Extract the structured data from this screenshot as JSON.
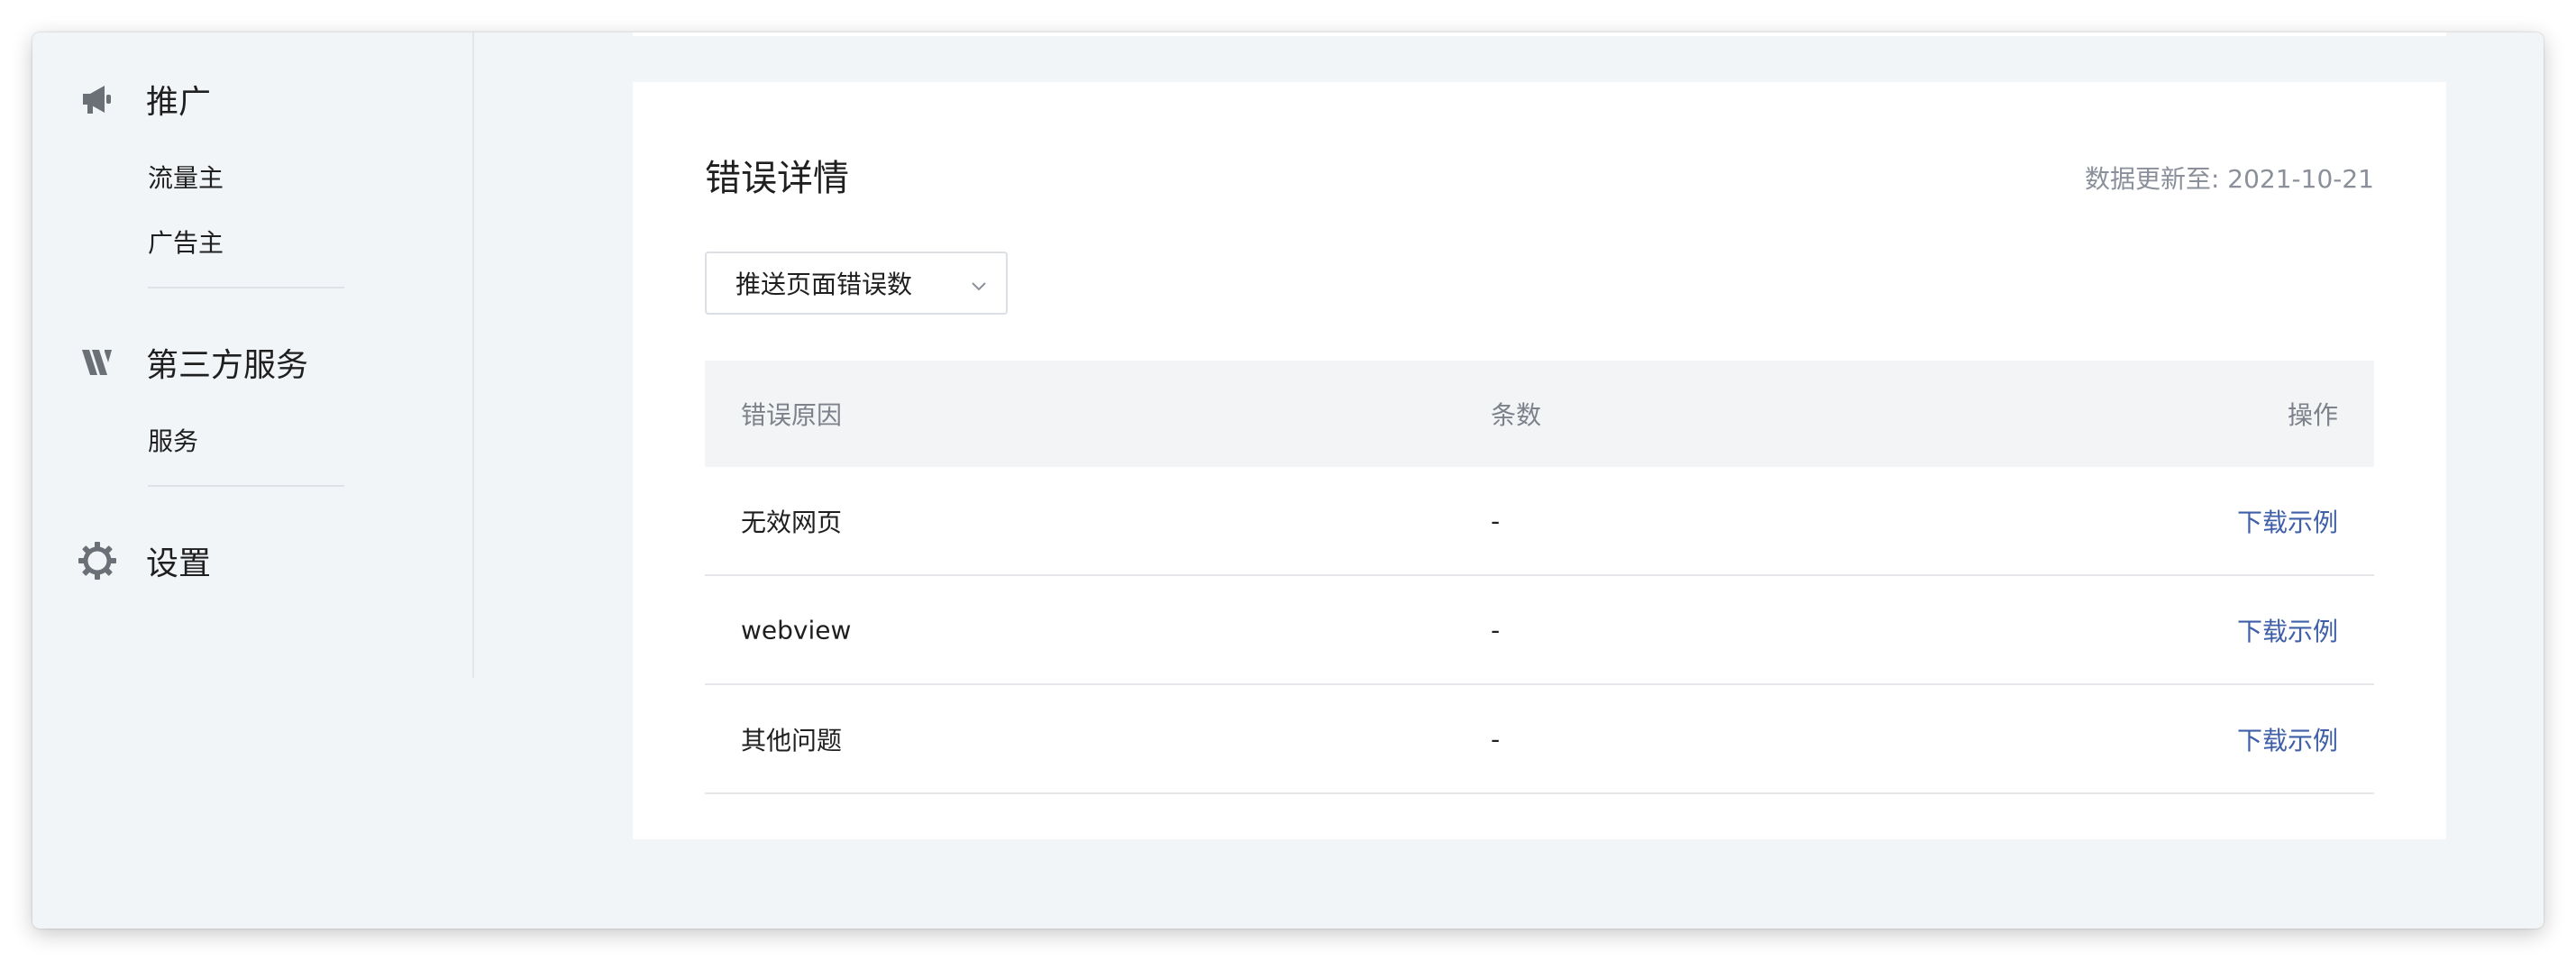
{
  "sidebar": {
    "groups": [
      {
        "label": "推广",
        "icon": "megaphone-icon",
        "items": [
          "流量主",
          "广告主"
        ]
      },
      {
        "label": "第三方服务",
        "icon": "third-party-logo-icon",
        "items": [
          "服务"
        ]
      },
      {
        "label": "设置",
        "icon": "gear-icon",
        "items": []
      }
    ]
  },
  "card": {
    "title": "错误详情",
    "updated_label": "数据更新至: 2021-10-21",
    "select": {
      "value": "推送页面错误数"
    },
    "table": {
      "headers": [
        "错误原因",
        "条数",
        "操作"
      ],
      "rows": [
        {
          "reason": "无效网页",
          "count": "-",
          "action": "下载示例"
        },
        {
          "reason": "webview",
          "count": "-",
          "action": "下载示例"
        },
        {
          "reason": "其他问题",
          "count": "-",
          "action": "下载示例"
        }
      ]
    }
  },
  "colors": {
    "background": "#f2f5f8",
    "card": "#ffffff",
    "link": "#3f5fa8",
    "muted_text": "#8a8f99",
    "table_header_bg": "#f3f4f6"
  }
}
